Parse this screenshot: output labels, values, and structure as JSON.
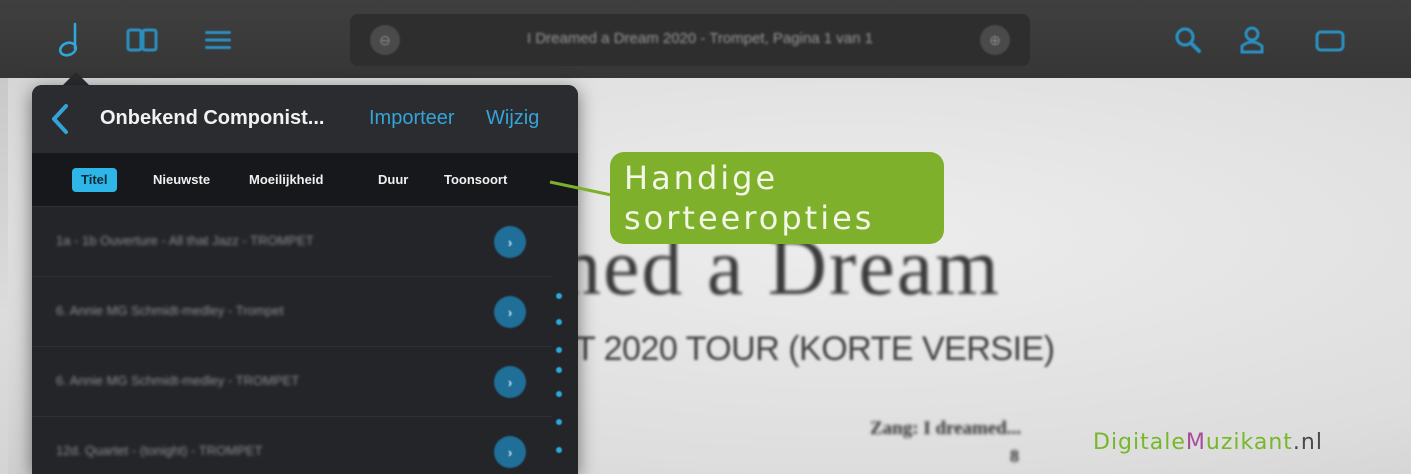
{
  "toolbar": {
    "document_title": "I Dreamed a Dream 2020 - Trompet, Pagina 1 van 1",
    "icons": [
      "note-icon",
      "book-icon",
      "menu-icon",
      "search-icon",
      "profile-icon",
      "folder-icon"
    ]
  },
  "sheet": {
    "title": "hed a Dream",
    "subtitle": "T 2020 TOUR (KORTE VERSIE)",
    "vocal_mark": "Zang: I dreamed...",
    "rehearsal_mark": "8"
  },
  "panel": {
    "title": "Onbekend Componist...",
    "import_label": "Importeer",
    "edit_label": "Wijzig",
    "sort_options": [
      {
        "label": "Titel",
        "active": true
      },
      {
        "label": "Nieuwste",
        "active": false
      },
      {
        "label": "Moeilijkheid",
        "active": false
      },
      {
        "label": "Duur",
        "active": false
      },
      {
        "label": "Toonsoort",
        "active": false
      }
    ],
    "items": [
      {
        "label": "1a - 1b Ouverture - All that Jazz - TROMPET"
      },
      {
        "label": "6. Annie MG Schmidt-medley - Trompet"
      },
      {
        "label": "6. Annie MG Schmidt-medley - TROMPET"
      },
      {
        "label": "12d. Quartet - (tonight) - TROMPET"
      }
    ]
  },
  "callout": {
    "line1": "Handige",
    "line2": "sorteeropties",
    "color": "#7fb02b"
  },
  "watermark": {
    "part1": "Digitale",
    "part2": "M",
    "part3": "uzikant",
    "part4": ".nl"
  },
  "colors": {
    "accent": "#34a4d8",
    "active_sort": "#2fb6e8"
  }
}
